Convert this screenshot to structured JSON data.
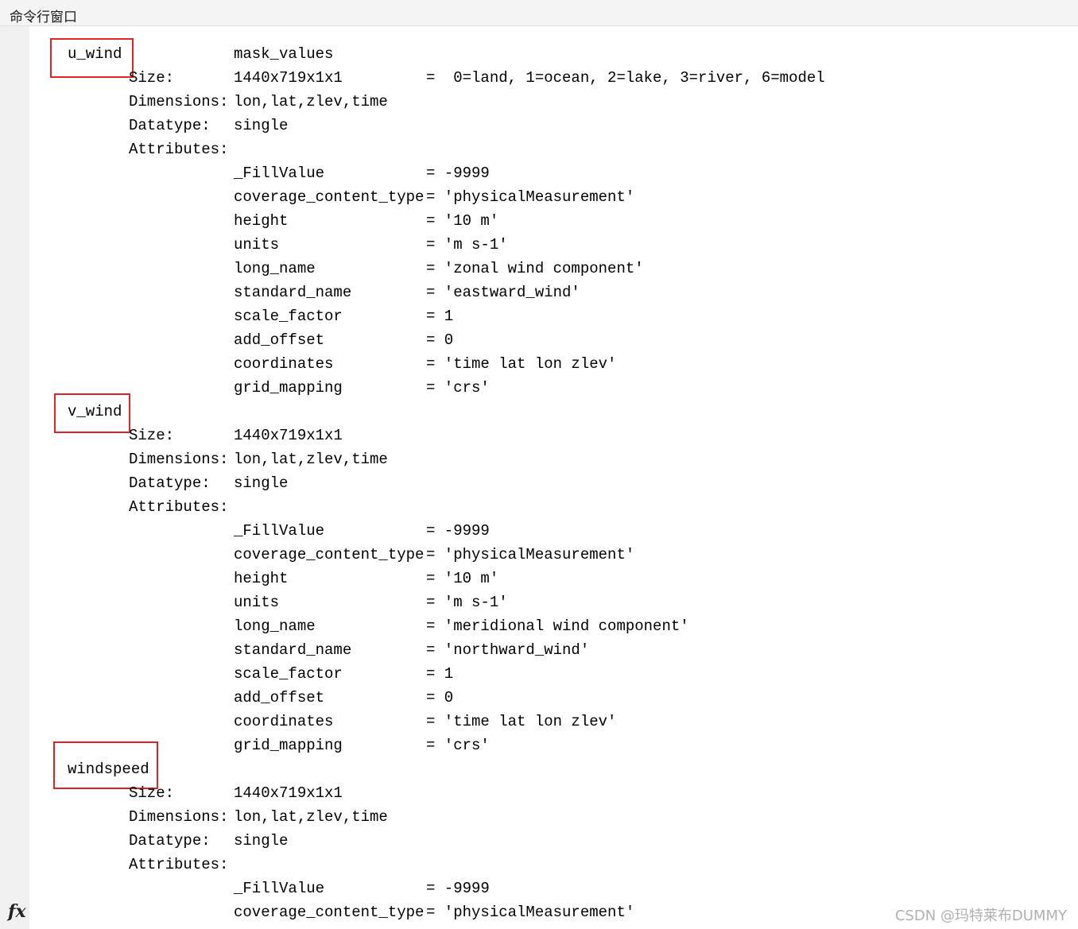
{
  "window": {
    "title": "命令行窗口"
  },
  "output": {
    "mask_line": {
      "name": "mask_values",
      "value": "=  0=land, 1=ocean, 2=lake, 3=river, 6=model"
    },
    "variables": [
      {
        "name": "u_wind",
        "size": "1440x719x1x1",
        "dimensions": "lon,lat,zlev,time",
        "datatype": "single",
        "attributes": [
          {
            "key": "_FillValue",
            "value": "= -9999"
          },
          {
            "key": "coverage_content_type",
            "value": "= 'physicalMeasurement'"
          },
          {
            "key": "height",
            "value": "= '10 m'"
          },
          {
            "key": "units",
            "value": "= 'm s-1'"
          },
          {
            "key": "long_name",
            "value": "= 'zonal wind component'"
          },
          {
            "key": "standard_name",
            "value": "= 'eastward_wind'"
          },
          {
            "key": "scale_factor",
            "value": "= 1"
          },
          {
            "key": "add_offset",
            "value": "= 0"
          },
          {
            "key": "coordinates",
            "value": "= 'time lat lon zlev'"
          },
          {
            "key": "grid_mapping",
            "value": "= 'crs'"
          }
        ]
      },
      {
        "name": "v_wind",
        "size": "1440x719x1x1",
        "dimensions": "lon,lat,zlev,time",
        "datatype": "single",
        "attributes": [
          {
            "key": "_FillValue",
            "value": "= -9999"
          },
          {
            "key": "coverage_content_type",
            "value": "= 'physicalMeasurement'"
          },
          {
            "key": "height",
            "value": "= '10 m'"
          },
          {
            "key": "units",
            "value": "= 'm s-1'"
          },
          {
            "key": "long_name",
            "value": "= 'meridional wind component'"
          },
          {
            "key": "standard_name",
            "value": "= 'northward_wind'"
          },
          {
            "key": "scale_factor",
            "value": "= 1"
          },
          {
            "key": "add_offset",
            "value": "= 0"
          },
          {
            "key": "coordinates",
            "value": "= 'time lat lon zlev'"
          },
          {
            "key": "grid_mapping",
            "value": "= 'crs'"
          }
        ]
      },
      {
        "name": "windspeed",
        "size": "1440x719x1x1",
        "dimensions": "lon,lat,zlev,time",
        "datatype": "single",
        "attributes": [
          {
            "key": "_FillValue",
            "value": "= -9999"
          },
          {
            "key": "coverage_content_type",
            "value": "= 'physicalMeasurement'"
          }
        ]
      }
    ],
    "labels": {
      "size": "Size:",
      "dimensions": "Dimensions:",
      "datatype": "Datatype:",
      "attributes": "Attributes:"
    }
  },
  "footer": {
    "fx_label": "fx",
    "watermark": "CSDN @玛特莱布DUMMY"
  },
  "colors": {
    "highlight_box": "#e02424"
  }
}
